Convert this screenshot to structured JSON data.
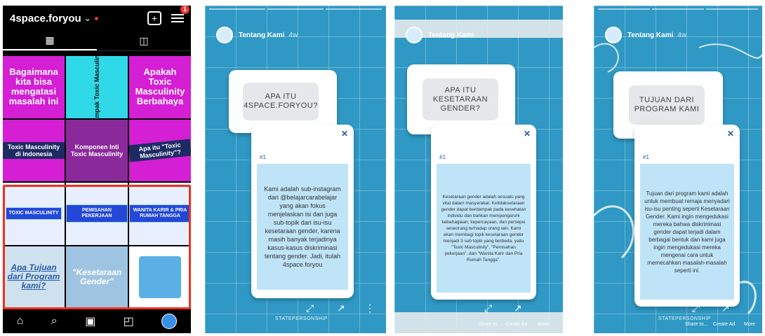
{
  "profile": {
    "username": "4space.foryou",
    "chevron": "⌄",
    "notification_count": "1",
    "add_icon": "plus-square-icon",
    "menu_icon": "menu-icon",
    "tabs": [
      "grid-icon",
      "tagged-icon"
    ],
    "tiles": [
      {
        "text": "Bagaimana kita bisa mengatasi masalah ini",
        "style": "mag"
      },
      {
        "text": "Dampak Toxic Masculinity",
        "style": "cy"
      },
      {
        "text": "Apakah Toxic Masculinity Berbahaya",
        "style": "mag"
      },
      {
        "text": "Toxic Masculinity di Indonesia",
        "style": "cy"
      },
      {
        "text": "Komponen Inti Toxic Masculinity",
        "style": "mag"
      },
      {
        "text": "Apa itu \"Toxic Masculinity\"?",
        "style": "mag"
      },
      {
        "text": "TOXIC MASCULINITY",
        "style": "blue"
      },
      {
        "text": "PEMISAHAN PEKERJAAN",
        "style": "blue"
      },
      {
        "text": "WANITA KARIR & PRIA RUMAH TANGGA",
        "style": "blue"
      },
      {
        "text": "Apa Tujuan dari Program kami?",
        "style": "light"
      },
      {
        "text": "\"Kesetaraan Gender\"",
        "style": "light"
      },
      {
        "text": "",
        "style": "light"
      }
    ],
    "nav": [
      "home-icon",
      "search-icon",
      "reels-icon",
      "shop-icon",
      "avatar"
    ]
  },
  "stories": [
    {
      "account": "Tentang Kami",
      "time": "4w",
      "question": "APA ITU 4SPACE.FORYOU?",
      "number": "#1",
      "answer": "Kami adalah sub-instagram dari @belajarcarabelajar yang akan fokus menjelaskan isi dan juga sub-topik dari isu-isu kesetaraan gender, karena masih banyak terjadinya kasus-kasus diskriminasi tentang gender. Jadi, itulah 4space.foryou",
      "sponsor": "STATEPERSONSHIP",
      "share": "",
      "create": "",
      "more": ""
    },
    {
      "account": "Tentang Kami",
      "time": "",
      "question": "APA ITU KESETARAAN GENDER?",
      "number": "#1",
      "answer": "Kesetaraan gender adalah sesuatu yang vital dalam masyarakat. Ketidaksetaraan gender dapat berdampak pada kesehatan individu dan bahkan mempengaruhi kebahagiaan, kepercayaan, dan persepsi seseorang terhadap orang lain. Kami akan membagi topik kesetaraan gender menjadi 3 sub topik yang berbeda, yaitu \"Toxic Masculinity\", \"Pemisahan pekerjaan\", dan \"Wanita Karir dan Pria Rumah Tangga\".",
      "sponsor": "",
      "share": "Share to...",
      "create": "Create Ad",
      "more": "More"
    },
    {
      "account": "Tentang Kami",
      "time": "4w",
      "question": "TUJUAN DARI PROGRAM KAMI",
      "number": "#1",
      "answer": "Tujuan dari program kami adalah untuk membuat remaja menyadari isu-isu penting seperti Kesetaraan Gender. Kami ingin mengedukasi mereka bahwa diskriminasi gender dapat terjadi dalam berbagai bentuk dan kami juga ingin mengedukasi mereka mengenai cara untuk memecahkan masalah-masalah seperti ini.",
      "sponsor": "STATEPERSONSHIP",
      "share": "Share to...",
      "create": "Create Ad",
      "more": "More"
    }
  ],
  "colors": {
    "story_bg": "#2f98c4",
    "highlight": "#f0301a",
    "answer_bg": "#bfe4f8"
  }
}
